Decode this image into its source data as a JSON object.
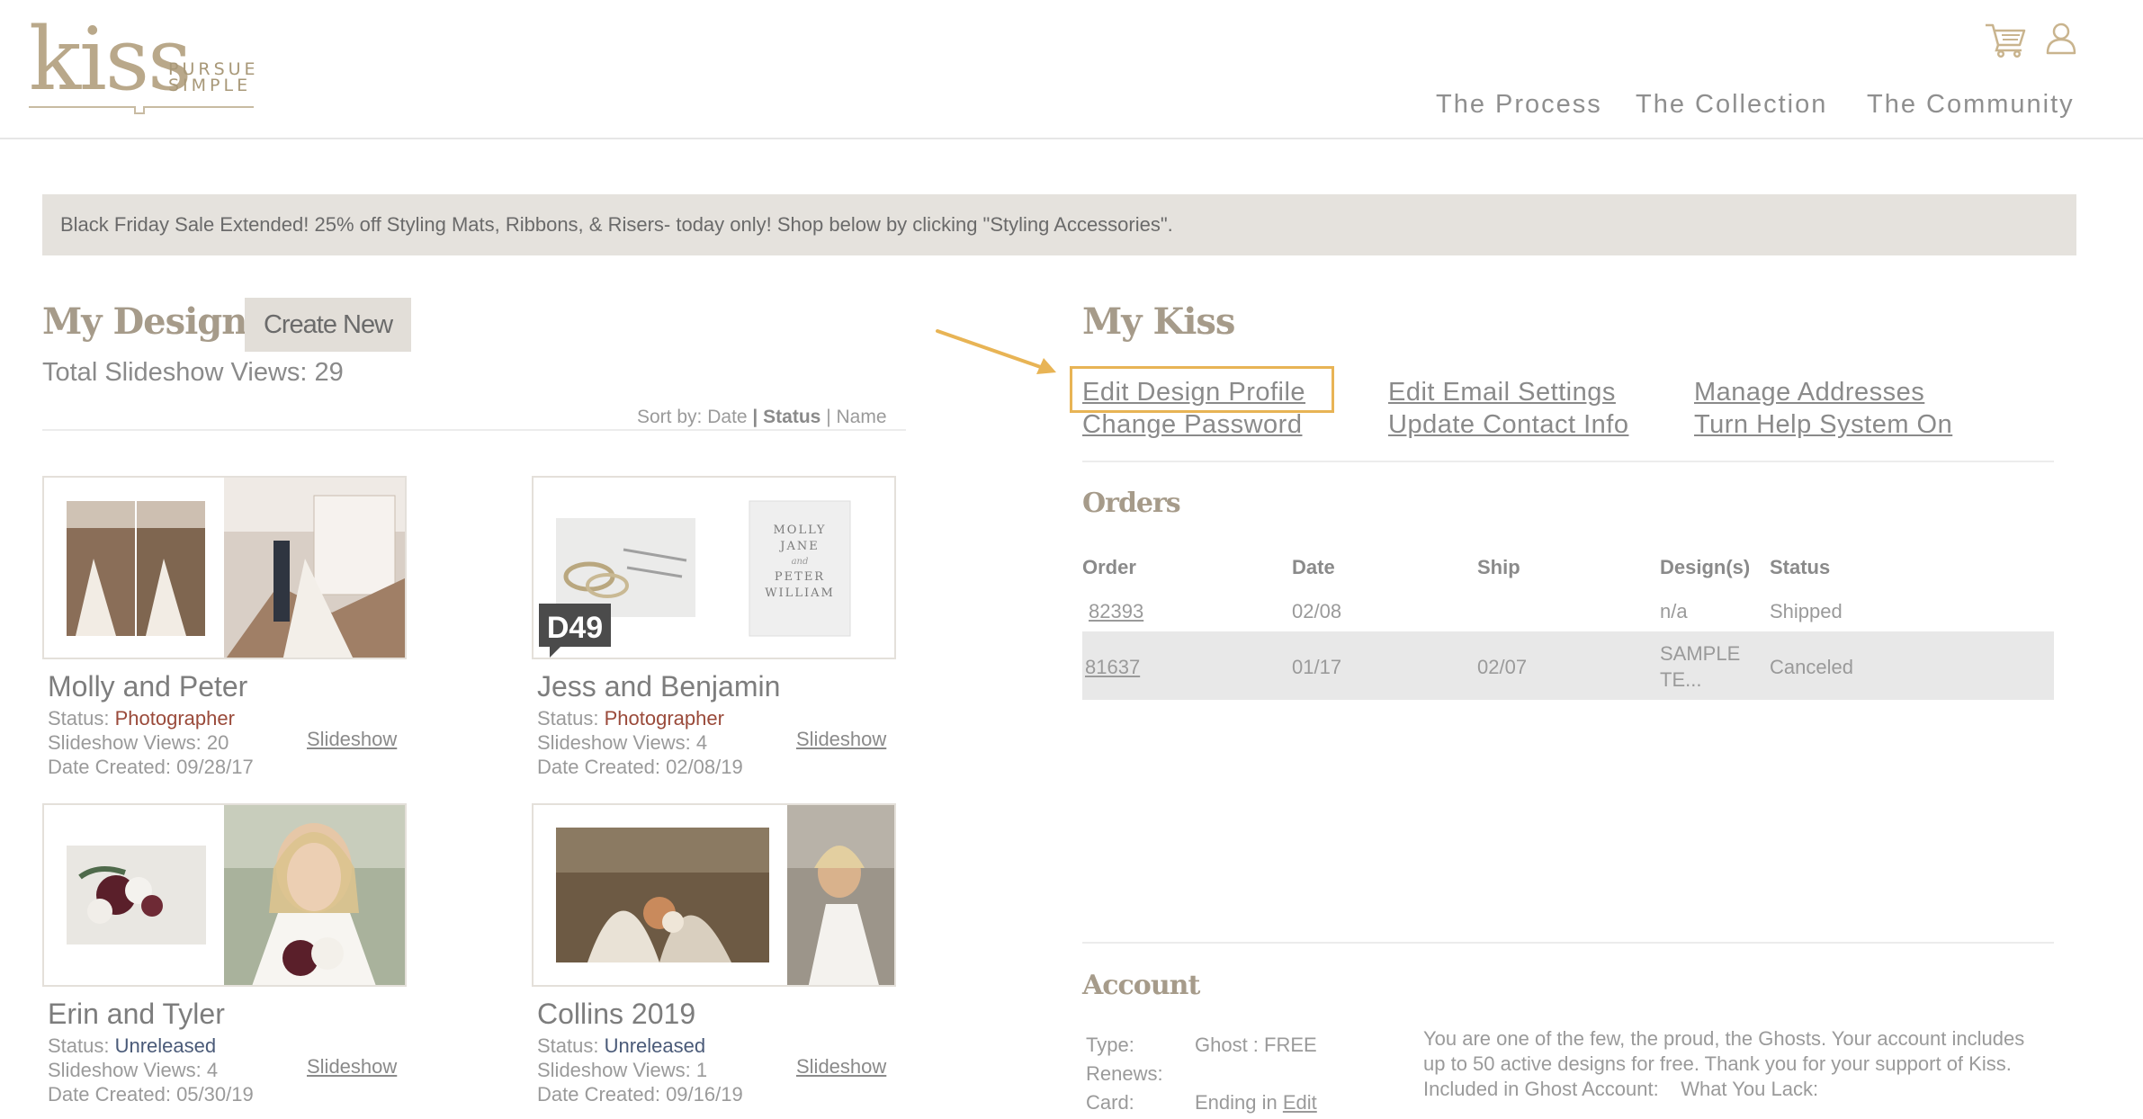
{
  "brand": {
    "word": "kiss",
    "tagline_1": "PURSUE",
    "tagline_2": "SIMPLE"
  },
  "header": {
    "icons": {
      "cart": "cart-icon",
      "account": "user-icon"
    },
    "nav": [
      "The Process",
      "The Collection",
      "The Community"
    ]
  },
  "banner": {
    "text": "Black Friday Sale Extended! 25% off Styling Mats, Ribbons, & Risers- today only! Shop below by clicking \"Styling Accessories\"."
  },
  "designs": {
    "title": "My Designs",
    "create_label": "Create New",
    "total_views": "Total Slideshow Views: 29",
    "sort": {
      "prefix": "Sort by:",
      "options": [
        "Date",
        "Status",
        "Name"
      ],
      "active": "Status",
      "separator": "|"
    },
    "cards": [
      {
        "name": "Molly and Peter",
        "status_label": "Status:",
        "status": "Photographer",
        "views": "Slideshow Views: 20",
        "date": "Date Created: 09/28/17",
        "slideshow": "Slideshow"
      },
      {
        "name": "Jess and Benjamin",
        "status_label": "Status:",
        "status": "Photographer",
        "views": "Slideshow Views: 4",
        "date": "Date Created: 02/08/19",
        "slideshow": "Slideshow",
        "badge": "D49",
        "invite_text": "MOLLY JANE and PETER WILLIAM"
      },
      {
        "name": "Erin and Tyler",
        "status_label": "Status:",
        "status": "Unreleased",
        "views": "Slideshow Views: 4",
        "date": "Date Created: 05/30/19",
        "slideshow": "Slideshow"
      },
      {
        "name": "Collins 2019",
        "status_label": "Status:",
        "status": "Unreleased",
        "views": "Slideshow Views: 1",
        "date": "Date Created: 09/16/19",
        "slideshow": "Slideshow"
      }
    ]
  },
  "my_kiss": {
    "title": "My Kiss",
    "links": [
      "Edit Design Profile",
      "Change Password",
      "Edit Email Settings",
      "Update Contact Info",
      "Manage Addresses",
      "Turn Help System On"
    ],
    "highlighted": "Edit Design Profile"
  },
  "orders": {
    "title": "Orders",
    "columns": [
      "Order",
      "Date",
      "Ship",
      "Design(s)",
      "Status"
    ],
    "rows": [
      {
        "order": "82393",
        "date": "02/08",
        "ship": "",
        "design": "n/a",
        "status": "Shipped"
      },
      {
        "order": "81637",
        "date": "01/17",
        "ship": "02/07",
        "design_line1": "SAMPLE",
        "design_line2": "TE...",
        "status": "Canceled"
      }
    ]
  },
  "account": {
    "title": "Account",
    "type_label": "Type:",
    "type_value": "Ghost : FREE",
    "renews_label": "Renews:",
    "card_label": "Card:",
    "card_value": "Ending in",
    "card_edit": "Edit",
    "description": "You are one of the few, the proud, the Ghosts. Your account includes up to 50 active designs for free. Thank you for your support of Kiss.",
    "included_label": "Included in Ghost Account:",
    "lack_label": "What You Lack:"
  },
  "colors": {
    "accent": "#e8b455",
    "title": "#a69b8a",
    "banner": "#e5e2dd",
    "photographer": "#9a4a3a",
    "unreleased": "#4a5a78"
  }
}
